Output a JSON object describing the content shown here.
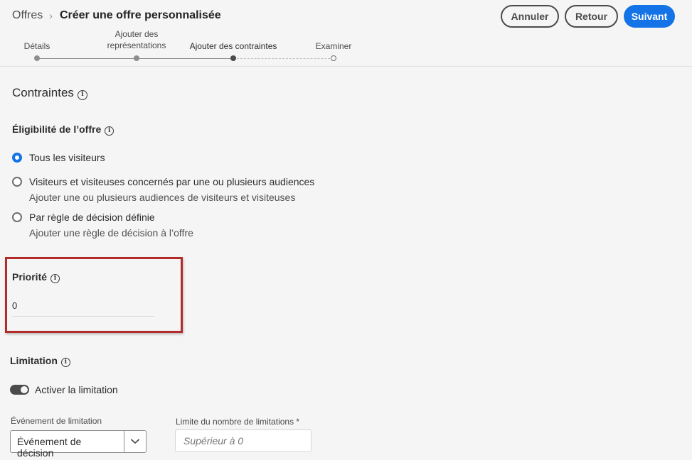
{
  "breadcrumb": {
    "root": "Offres",
    "separator": "›",
    "current": "Créer une offre personnalisée"
  },
  "actions": {
    "cancel": "Annuler",
    "back": "Retour",
    "next": "Suivant"
  },
  "steps": [
    {
      "label": "Détails",
      "state": "done"
    },
    {
      "label": "Ajouter des représentations",
      "state": "done"
    },
    {
      "label": "Ajouter des contraintes",
      "state": "current"
    },
    {
      "label": "Examiner",
      "state": "todo"
    }
  ],
  "constraints": {
    "title": "Contraintes",
    "eligibility": {
      "title": "Éligibilité de l’offre",
      "options": [
        {
          "label": "Tous les visiteurs",
          "desc": "",
          "checked": true
        },
        {
          "label": "Visiteurs et visiteuses concernés par une ou plusieurs audiences",
          "desc": "Ajouter une ou plusieurs audiences de visiteurs et visiteuses",
          "checked": false
        },
        {
          "label": "Par règle de décision définie",
          "desc": "Ajouter une règle de décision à l’offre",
          "checked": false
        }
      ]
    },
    "priority": {
      "title": "Priorité",
      "value": "0"
    },
    "capping": {
      "title": "Limitation",
      "toggle_label": "Activer la limitation",
      "toggle_on": true,
      "event_label": "Événement de limitation",
      "event_value": "Événement de décision",
      "limit_label": "Limite du nombre de limitations",
      "limit_required": "*",
      "limit_placeholder": "Supérieur à 0"
    }
  },
  "icons": {
    "info": "info-icon",
    "chevron": "chevron-down-icon"
  },
  "colors": {
    "accent": "#1473e6",
    "highlight": "#b22a2a"
  }
}
